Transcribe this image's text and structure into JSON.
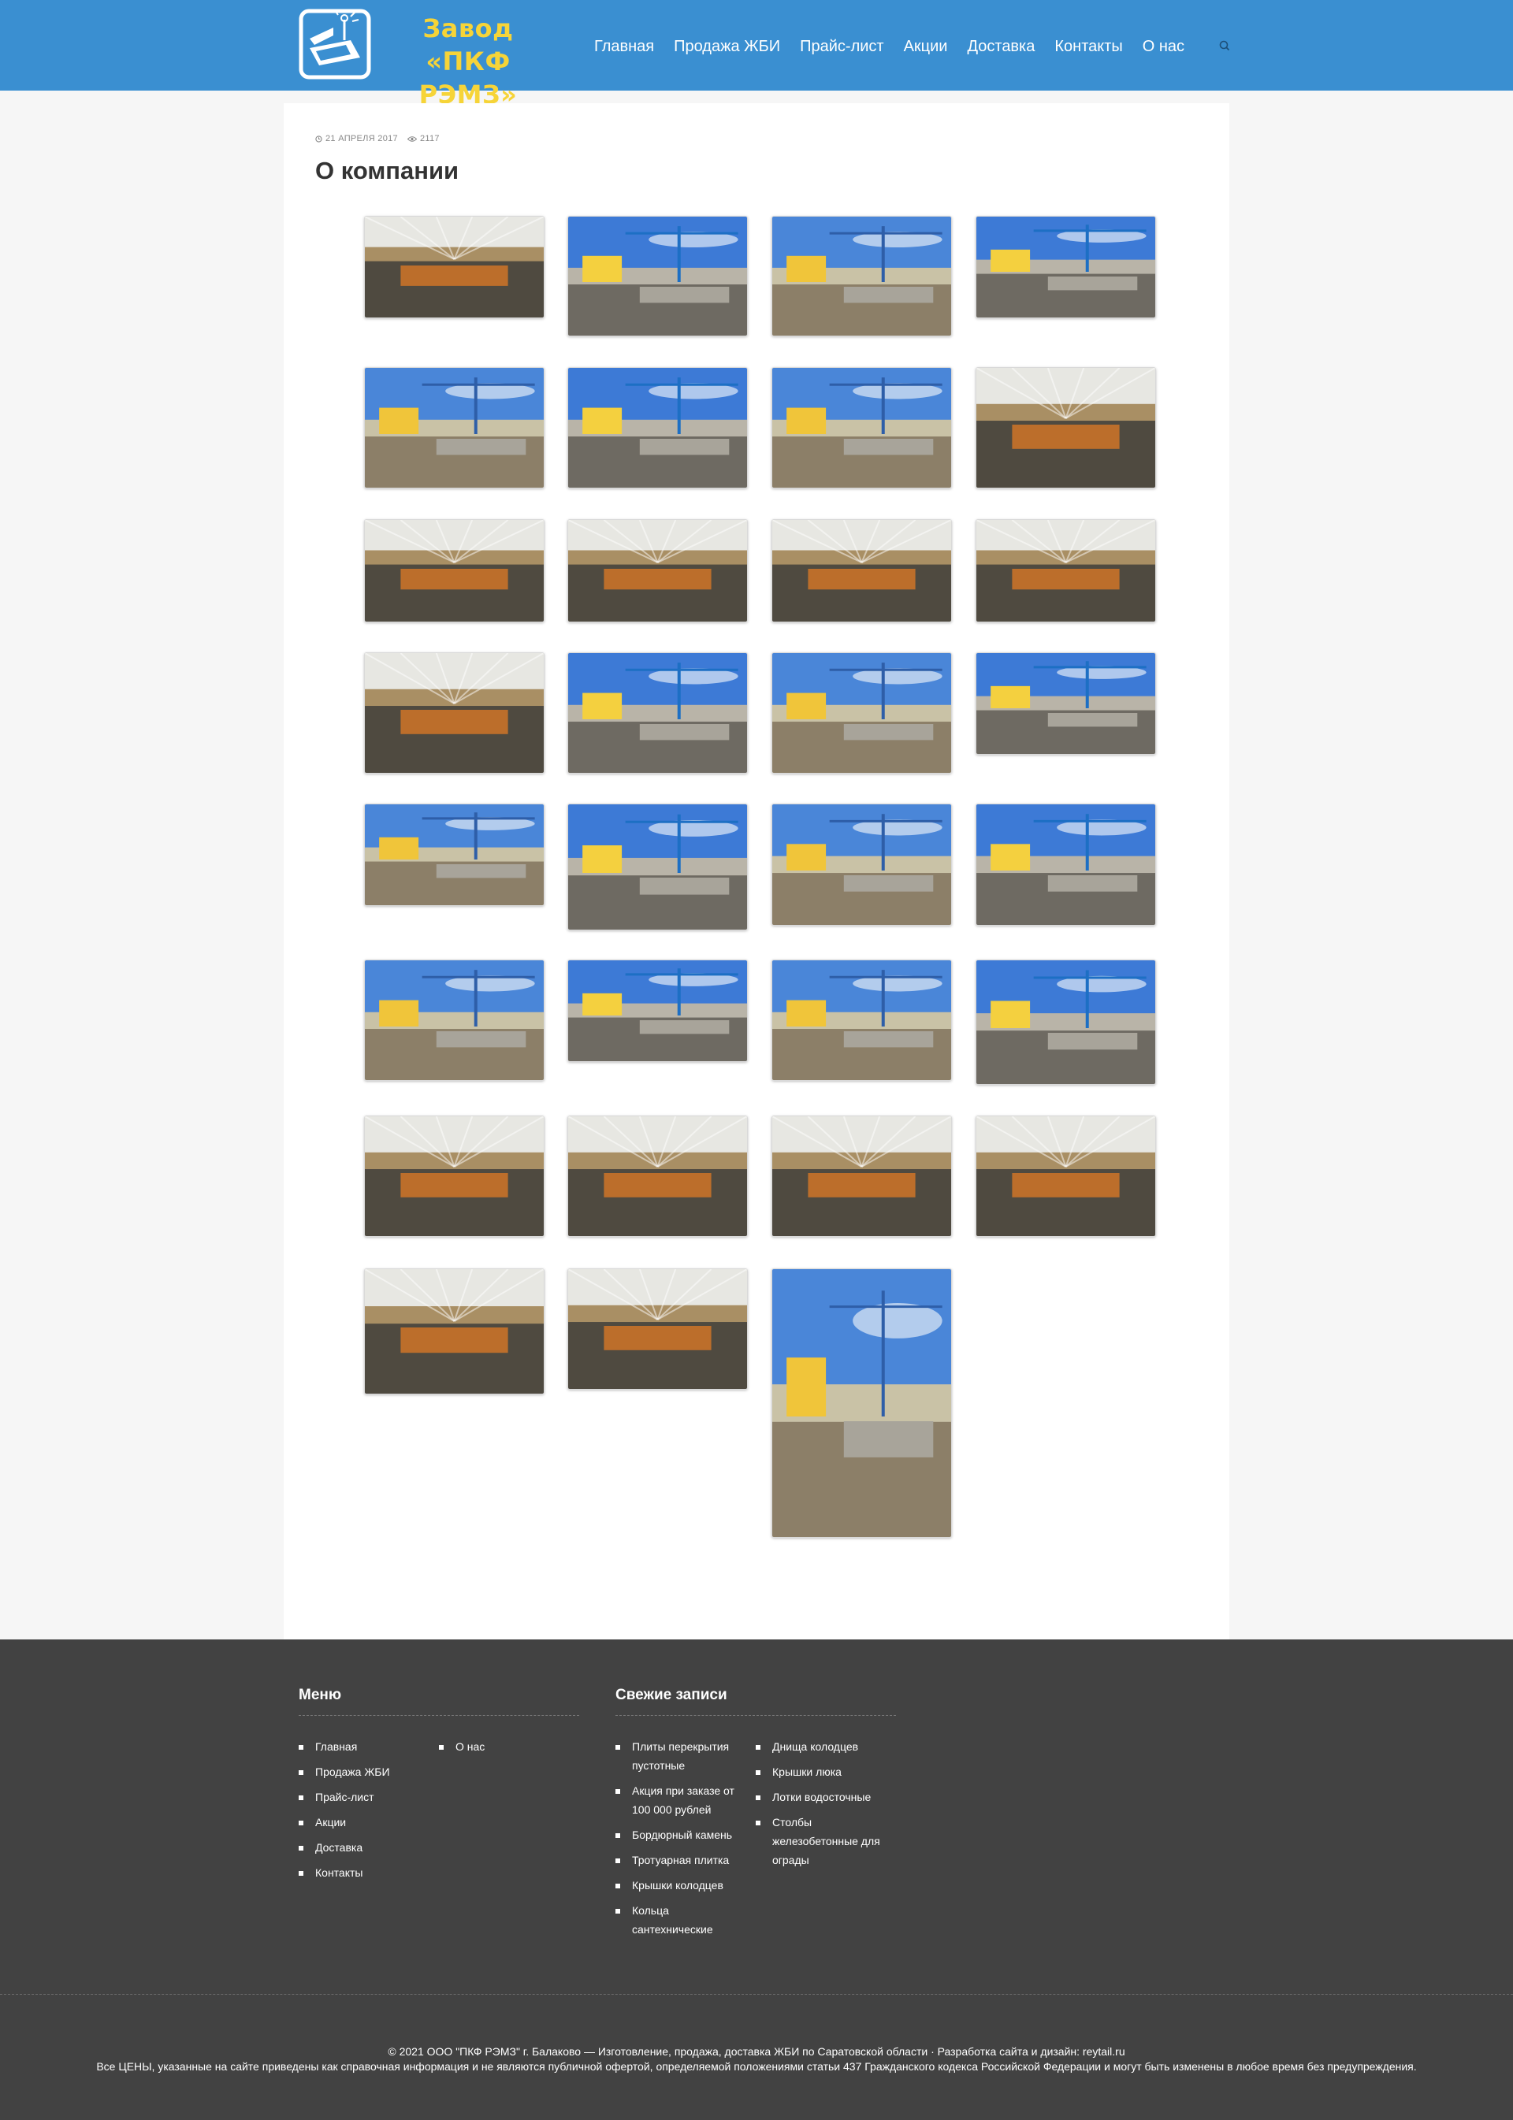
{
  "header": {
    "logo_line1": "Завод",
    "logo_line2": "«ПКФ РЭМЗ»",
    "nav": [
      "Главная",
      "Продажа ЖБИ",
      "Прайс-лист",
      "Акции",
      "Доставка",
      "Контакты",
      "О нас"
    ]
  },
  "post": {
    "date": "21 АПРЕЛЯ 2017",
    "views": "2117",
    "title": "О компании"
  },
  "gallery": {
    "photos": [
      "office-reception",
      "factory-building-yellow",
      "tower-crane-yard",
      "gantry-crane-yard",
      "tower-crane-building",
      "tower-crane-slabs",
      "tower-crane-building-2",
      "workshop-interior",
      "workshop-crane",
      "workshop-floor",
      "workshop-wide",
      "workshop-yellow-crane",
      "workshop-windows",
      "yard-slabs-gantry",
      "gantry-crane-sky",
      "gantry-crane-rails",
      "gantry-crane-blue",
      "cement-silos",
      "silos-crane",
      "well-rings-silo",
      "well-rings-yard",
      "stacked-slabs",
      "sand-pile-building",
      "sand-plant",
      "orange-racks",
      "orange-machine",
      "red-crane-shop",
      "blue-shop-interior",
      "block-machine",
      "concrete-blocks",
      "tall-crane"
    ]
  },
  "footer": {
    "menu_title": "Меню",
    "menu": [
      "Главная",
      "Продажа ЖБИ",
      "Прайс-лист",
      "Акции",
      "Доставка",
      "Контакты",
      "О нас"
    ],
    "posts_title": "Свежие записи",
    "posts_col1": [
      "Плиты перекрытия пустотные",
      "Акция при заказе от 100 000 рублей",
      "Бордюрный камень",
      "Тротуарная плитка",
      "Крышки колодцев",
      "Кольца сантехнические"
    ],
    "posts_col2": [
      "Днища колодцев",
      "Крышки люка",
      "Лотки водосточные",
      "Столбы железобетонные для ограды"
    ],
    "copyright_text": "© 2021 ООО \"ПКФ РЭМЗ\" г. Балаково — Изготовление, продажа, доставка ЖБИ по Саратовской области · Разработка сайта и дизайн: ",
    "copyright_link": "reytail.ru",
    "disclaimer": "Все ЦЕНЫ, указанные на сайте приведены как справочная информация и не являются публичной офертой, определяемой положениями статьи 437 Гражданского кодекса Российской Федерации и могут быть изменены в любое время без предупреждения."
  }
}
